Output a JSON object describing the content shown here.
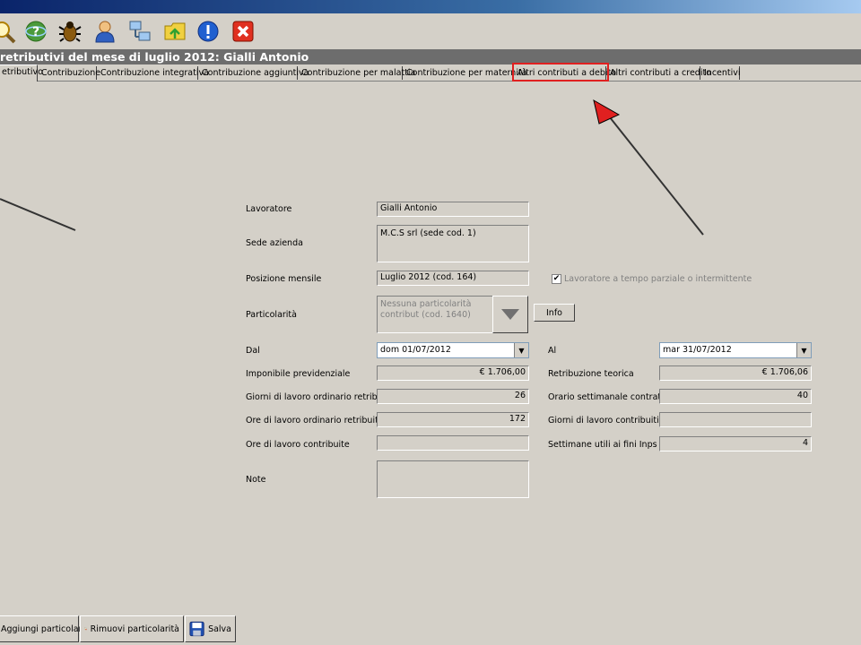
{
  "toolbar": {
    "icons": [
      "search-icon",
      "help-icon",
      "bug-icon",
      "user-icon",
      "network-icon",
      "folder-icon",
      "info-icon",
      "close-icon"
    ]
  },
  "form": {
    "title": "retributivi del mese di luglio 2012: Gialli Antonio"
  },
  "tabs": [
    {
      "label": "etributivo",
      "active": true
    },
    {
      "label": "Contribuzione"
    },
    {
      "label": "Contribuzione integrativa"
    },
    {
      "label": "Contribuzione aggiuntiva"
    },
    {
      "label": "Contribuzione per malattia"
    },
    {
      "label": "Contribuzione per maternità"
    },
    {
      "label": "Altri contributi a debito",
      "highlighted": true
    },
    {
      "label": "Altri contributi a credito"
    },
    {
      "label": "Incentivi"
    }
  ],
  "fields": {
    "lavoratore_label": "Lavoratore",
    "lavoratore_value": "Gialli Antonio",
    "sede_label": "Sede azienda",
    "sede_value": "M.C.S srl (sede cod. 1)",
    "posizione_label": "Posizione mensile",
    "posizione_value": "Luglio 2012 (cod. 164)",
    "parttime_label": "Lavoratore a tempo parziale o intermittente",
    "parttime_checked": true,
    "particolarita_label": "Particolarità",
    "particolarita_value": "Nessuna particolarità contribut (cod. 1640)",
    "info_button": "Info",
    "dal_label": "Dal",
    "dal_value": "dom 01/07/2012",
    "al_label": "Al",
    "al_value": "mar 31/07/2012",
    "imponibile_label": "Imponibile previdenziale",
    "imponibile_value": "€ 1.706,00",
    "retribuzione_label": "Retribuzione teorica",
    "retribuzione_value": "€ 1.706,06",
    "giorni_retribuiti_label": "Giorni di lavoro ordinario retribuiti",
    "giorni_retribuiti_value": "26",
    "orario_label": "Orario settimanale contratt.",
    "orario_value": "40",
    "ore_retribuite_label": "Ore di lavoro ordinario retribuite",
    "ore_retribuite_value": "172",
    "giorni_contribuiti_label": "Giorni di lavoro contribuiti",
    "giorni_contribuiti_value": "",
    "ore_contribuite_label": "Ore di lavoro contribuite",
    "ore_contribuite_value": "",
    "settimane_label": "Settimane utili ai fini Inps",
    "settimane_value": "4",
    "note_label": "Note",
    "note_value": ""
  },
  "bottom": {
    "aggiungi": "Aggiungi particolarità",
    "rimuovi": "Rimuovi particolarità",
    "salva": "Salva"
  },
  "colors": {
    "highlight": "#e02020",
    "arrow": "#333333",
    "arrow_head": "#e02020"
  }
}
